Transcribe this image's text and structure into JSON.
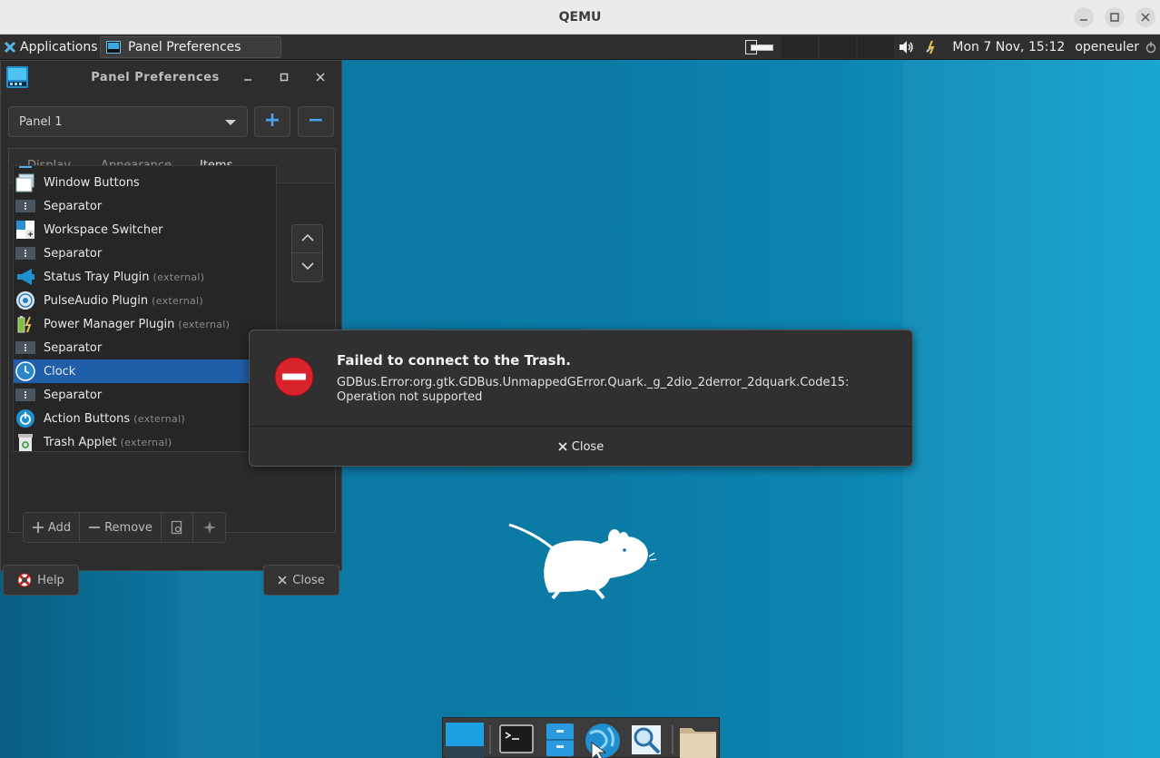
{
  "qemu": {
    "title": "QEMU"
  },
  "panel": {
    "applications_label": "Applications",
    "task_label": "Panel Preferences",
    "clock": "Mon  7 Nov, 15:12",
    "user": "openeuler"
  },
  "prefs": {
    "title": "Panel Preferences",
    "panel_select": "Panel 1",
    "add_panel_symbol": "+",
    "remove_panel_symbol": "−",
    "tabs": [
      "Display",
      "Appearance",
      "Items"
    ],
    "active_tab": "Items",
    "items": [
      {
        "label": "Window Buttons",
        "ext": "",
        "icon": "window-buttons-icon"
      },
      {
        "label": "Separator",
        "ext": "",
        "icon": "separator-icon"
      },
      {
        "label": "Workspace Switcher",
        "ext": "",
        "icon": "workspace-switcher-icon"
      },
      {
        "label": "Separator",
        "ext": "",
        "icon": "separator-icon"
      },
      {
        "label": "Status Tray Plugin",
        "ext": "(external)",
        "icon": "status-tray-icon"
      },
      {
        "label": "PulseAudio Plugin",
        "ext": "(external)",
        "icon": "pulseaudio-icon"
      },
      {
        "label": "Power Manager Plugin",
        "ext": "(external)",
        "icon": "power-manager-icon"
      },
      {
        "label": "Separator",
        "ext": "",
        "icon": "separator-icon"
      },
      {
        "label": "Clock",
        "ext": "",
        "icon": "clock-icon",
        "selected": true
      },
      {
        "label": "Separator",
        "ext": "",
        "icon": "separator-icon"
      },
      {
        "label": "Action Buttons",
        "ext": "(external)",
        "icon": "action-buttons-icon"
      },
      {
        "label": "Trash Applet",
        "ext": "(external)",
        "icon": "trash-applet-icon"
      }
    ],
    "toolbar": {
      "add": "Add",
      "remove": "Remove"
    },
    "help": "Help",
    "close": "Close"
  },
  "error_dialog": {
    "title": "Failed to connect to the Trash.",
    "message_line1": "GDBus.Error:org.gtk.GDBus.UnmappedGError.Quark._g_2dio_2derror_2dquark.Code15:",
    "message_line2": "Operation not supported",
    "close": "Close"
  },
  "colors": {
    "accent": "#1f5ea8",
    "desktop": "#0b7aa5",
    "error": "#d9232b"
  }
}
